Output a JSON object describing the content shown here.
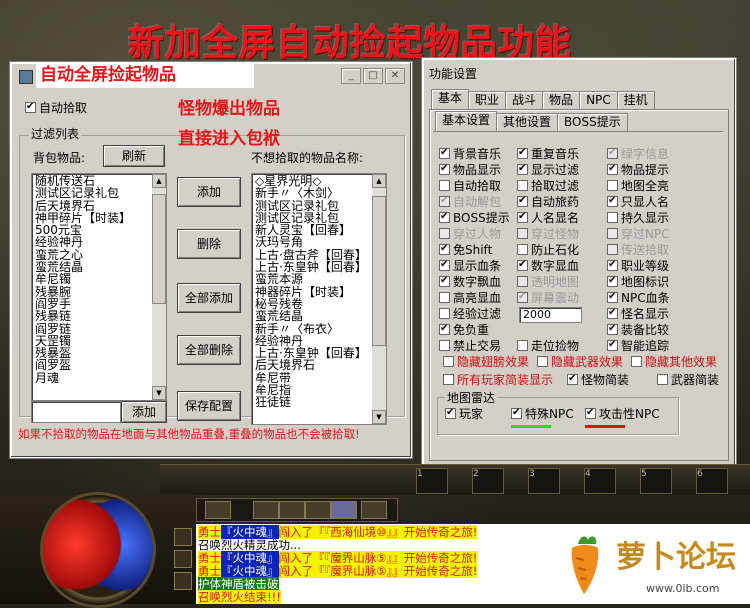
{
  "banner": "新加全屏自动捡起物品功能",
  "left_window": {
    "overlay_title": "自动全屏捡起物品",
    "caption_2": "怪物爆出物品",
    "caption_3": "直接进入包袱",
    "auto_pickup_label": "自动拾取",
    "filter_group": "过滤列表",
    "bag_items_label": "背包物品:",
    "refresh_button": "刷新",
    "unwanted_label": "不想拾取的物品名称:",
    "bag_items": [
      "随机传送石",
      "测试区记录礼包",
      "后天境界石",
      "神甲碎片【时装】",
      "500元宝",
      "经验神丹",
      "蛮荒之心",
      "蛮荒结晶",
      "牟尼镯",
      "残暴腕",
      "阎罗手",
      "残暴链",
      "阎罗链",
      "天罡镯",
      "残暴盔",
      "阎罗盔",
      "月魂"
    ],
    "unwanted_items": [
      "◇星界光明◇",
      "新手〃〈木剑〉",
      "测试区记录礼包",
      "测试区记录礼包",
      "新人灵宝【回春】",
      "沃玛号角",
      "上古·盘古斧【回春】",
      "上古·东皇钟【回春】",
      "蛮荒本源",
      "神器碎片【时装】",
      "秘号残卷",
      "蛮荒结晶",
      "新手〃〈布衣〉",
      "经验神丹",
      "上古·东皇钟【回春】",
      "后天境界石",
      "牟尼带",
      "牟尼指",
      "狂徒链"
    ],
    "buttons": {
      "add": "添加",
      "delete": "删除",
      "add_all": "全部添加",
      "delete_all": "全部删除",
      "save": "保存配置",
      "add_bottom": "添加"
    },
    "notice": "如果不拾取的物品在地面与其他物品重叠,重叠的物品也不会被拾取!"
  },
  "right_window": {
    "title": "功能设置",
    "tabs": [
      "基本",
      "职业",
      "战斗",
      "物品",
      "NPC",
      "挂机"
    ],
    "subtabs": [
      "基本设置",
      "其他设置",
      "BOSS提示"
    ],
    "options": [
      {
        "label": "背景音乐",
        "on": true,
        "dis": false
      },
      {
        "label": "重复音乐",
        "on": true,
        "dis": false
      },
      {
        "label": "绿字信息",
        "on": true,
        "dis": true
      },
      {
        "label": "物品显示",
        "on": true,
        "dis": false
      },
      {
        "label": "显示过滤",
        "on": true,
        "dis": false
      },
      {
        "label": "物品提示",
        "on": true,
        "dis": false
      },
      {
        "label": "自动拾取",
        "on": false,
        "dis": false
      },
      {
        "label": "拾取过滤",
        "on": false,
        "dis": false
      },
      {
        "label": "地图全亮",
        "on": false,
        "dis": false
      },
      {
        "label": "自动解包",
        "on": true,
        "dis": true
      },
      {
        "label": "自动旅药",
        "on": true,
        "dis": false
      },
      {
        "label": "只显人名",
        "on": true,
        "dis": false
      },
      {
        "label": "BOSS提示",
        "on": true,
        "dis": false
      },
      {
        "label": "人名显名",
        "on": true,
        "dis": false
      },
      {
        "label": "持久显示",
        "on": false,
        "dis": false
      },
      {
        "label": "穿过人物",
        "on": false,
        "dis": true
      },
      {
        "label": "穿过怪物",
        "on": false,
        "dis": true
      },
      {
        "label": "穿过NPC",
        "on": false,
        "dis": true
      },
      {
        "label": "免Shift",
        "on": true,
        "dis": false
      },
      {
        "label": "防止石化",
        "on": false,
        "dis": false
      },
      {
        "label": "传送拾取",
        "on": false,
        "dis": true
      },
      {
        "label": "显示血条",
        "on": true,
        "dis": false
      },
      {
        "label": "数字显血",
        "on": true,
        "dis": false
      },
      {
        "label": "职业等级",
        "on": true,
        "dis": false
      },
      {
        "label": "数字飘血",
        "on": true,
        "dis": false
      },
      {
        "label": "透明地图",
        "on": false,
        "dis": true
      },
      {
        "label": "地图标识",
        "on": true,
        "dis": false
      },
      {
        "label": "高亮显血",
        "on": false,
        "dis": false
      },
      {
        "label": "屏幕震动",
        "on": true,
        "dis": true
      },
      {
        "label": "NPC血条",
        "on": true,
        "dis": false
      },
      {
        "label": "经验过滤",
        "on": false,
        "dis": false
      },
      {
        "label": "",
        "on": false,
        "dis": false
      },
      {
        "label": "怪名显示",
        "on": true,
        "dis": false
      },
      {
        "label": "免负重",
        "on": true,
        "dis": false
      },
      {
        "label": "",
        "on": false,
        "dis": false
      },
      {
        "label": "装备比较",
        "on": true,
        "dis": false
      },
      {
        "label": "禁止交易",
        "on": false,
        "dis": false
      },
      {
        "label": "走位捡物",
        "on": false,
        "dis": false
      },
      {
        "label": "智能追踪",
        "on": true,
        "dis": false
      }
    ],
    "exp_value": "2000",
    "red_opts": [
      "隐藏翅膀效果",
      "隐藏武器效果",
      "隐藏其他效果"
    ],
    "all_players_label": "所有玩家简装显示",
    "monster_simple_label": "怪物简装",
    "weapon_simple_label": "武器简装",
    "radar_group": "地图雷达",
    "radar": [
      {
        "label": "玩家",
        "on": true
      },
      {
        "label": "特殊NPC",
        "on": true
      },
      {
        "label": "攻击性NPC",
        "on": true
      }
    ],
    "colors": {
      "special_npc": "#20e020",
      "hostile_npc": "#e01010"
    }
  },
  "hud": {
    "slots": [
      "1",
      "2",
      "3",
      "4",
      "5",
      "6"
    ]
  },
  "chat": [
    {
      "parts": [
        {
          "t": "勇士",
          "c": "cy"
        },
        {
          "t": "『火中魂』",
          "c": "cb2"
        },
        {
          "t": "闯入了『『西海仙境⑩』』开始传奇之旅!",
          "c": "cy"
        }
      ]
    },
    {
      "parts": [
        {
          "t": "召唤烈火精灵成功...",
          "c": "plain"
        }
      ]
    },
    {
      "parts": [
        {
          "t": "勇士",
          "c": "cy"
        },
        {
          "t": "『火中魂』",
          "c": "cb2"
        },
        {
          "t": "闯入了『『魔界山脉⑤』』开始传奇之旅!",
          "c": "cy"
        }
      ]
    },
    {
      "parts": [
        {
          "t": "勇士",
          "c": "cy"
        },
        {
          "t": "『火中魂』",
          "c": "cb2"
        },
        {
          "t": "闯入了『『魔界山脉⑤』』开始传奇之旅!",
          "c": "cy"
        }
      ]
    },
    {
      "parts": [
        {
          "t": "护体神盾被击破",
          "c": "cg"
        }
      ]
    },
    {
      "parts": [
        {
          "t": "召唤烈火结束!!!",
          "c": "cy"
        }
      ]
    }
  ],
  "logo": {
    "text": "萝卜论坛",
    "url": "www.0lb.com"
  }
}
